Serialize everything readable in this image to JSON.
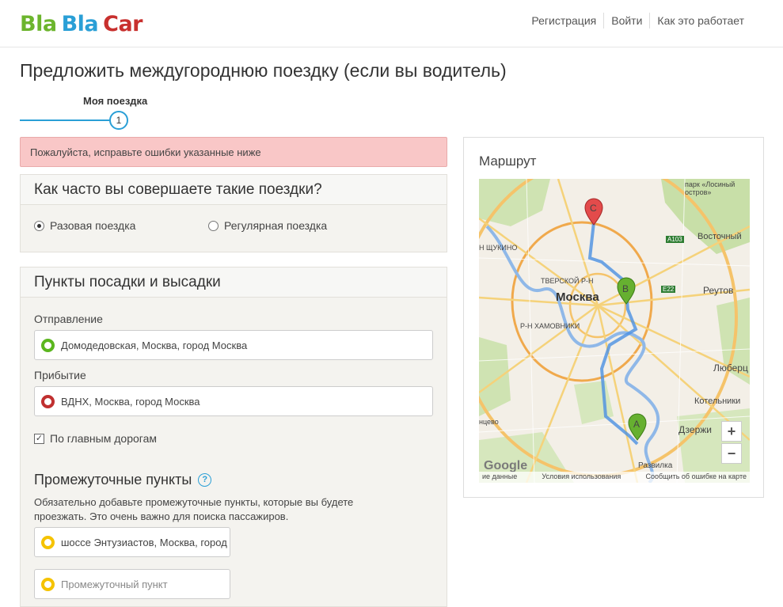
{
  "header": {
    "logo": {
      "part1": "Bla",
      "part2": "Bla",
      "part3": "Car",
      "color1": "#6cb52d",
      "color2": "#2a9fd6",
      "color3": "#c8302e"
    },
    "nav": [
      "Регистрация",
      "Войти",
      "Как это работает"
    ]
  },
  "page_title": "Предложить междугороднюю поездку (если вы водитель)",
  "stepper": {
    "label": "Моя поездка",
    "number": "1"
  },
  "error": "Пожалуйста, исправьте ошибки указанные ниже",
  "frequency": {
    "title": "Как часто вы совершаете такие поездки?",
    "options": [
      "Разовая поездка",
      "Регулярная поездка"
    ],
    "selected": "Разовая поездка"
  },
  "points": {
    "title": "Пункты посадки и высадки",
    "departure_label": "Отправление",
    "departure_value": "Домодедовская, Москва, город Москва",
    "arrival_label": "Прибытие",
    "arrival_value": "ВДНХ, Москва, город Москва",
    "main_roads_label": "По главным дорогам",
    "intermediate_title": "Промежуточные пункты",
    "intermediate_note": "Обязательно добавьте промежуточные пункты, которые вы будете проезжать. Это очень важно для поиска пассажиров.",
    "intermediate_value": "шоссе Энтузиастов, Москва, город Москва",
    "intermediate_placeholder": "Промежуточный пункт"
  },
  "route": {
    "title": "Маршрут",
    "map_labels": {
      "moscow": "Москва",
      "tverskoy": "ТВЕРСКОЙ Р-Н",
      "khamovniki": "Р-Н ХАМОВНИКИ",
      "shchukino": "Н ЩУКИНО",
      "vostochny": "Восточный",
      "reutov": "Реутов",
      "lyuber": "Люберц",
      "kotelniki": "Котельники",
      "dzerzh": "Дзержи",
      "razvilka": "Развилка",
      "park": "парк «Лосиный остров»",
      "ntsevo": "нцево",
      "a103": "A103",
      "e22": "E22"
    },
    "markers": {
      "a": "A",
      "b": "B",
      "c": "C"
    },
    "zoom_in": "+",
    "zoom_out": "−",
    "google": "Google",
    "footer": [
      "ие данные",
      "Условия использования",
      "Сообщить об ошибке на карте"
    ]
  }
}
